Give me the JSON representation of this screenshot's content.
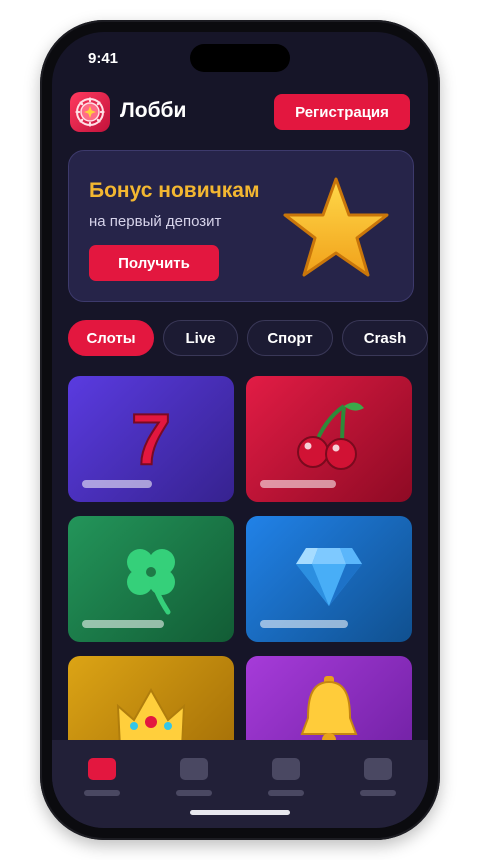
{
  "status_bar": {
    "time": "9:41"
  },
  "header": {
    "title": "Лобби",
    "logo_icon": "chip-icon",
    "register_label": "Регистрация"
  },
  "banner": {
    "title": "Бонус новичкам",
    "subtitle": "на первый депозит",
    "button_label": "Получить",
    "icon": "star-icon"
  },
  "tabs": [
    {
      "label": "Слоты",
      "active": true
    },
    {
      "label": "Live",
      "active": false
    },
    {
      "label": "Спорт",
      "active": false
    },
    {
      "label": "Crash",
      "active": false
    }
  ],
  "games": [
    {
      "icon": "seven-icon",
      "color": "#4b32c4"
    },
    {
      "icon": "cherry-icon",
      "color": "#c4102f"
    },
    {
      "icon": "clover-icon",
      "color": "#1b7f4a"
    },
    {
      "icon": "diamond-icon",
      "color": "#1e6ed8"
    },
    {
      "icon": "crown-icon",
      "color": "#c78a0a"
    },
    {
      "icon": "bell-icon",
      "color": "#8e2cc7"
    }
  ],
  "colors": {
    "accent": "#e3173f",
    "background": "#161528",
    "banner_title": "#f3b731"
  }
}
